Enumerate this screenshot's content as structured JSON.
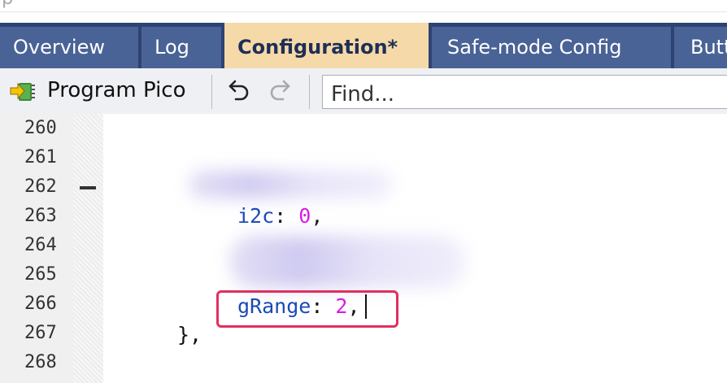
{
  "window": {
    "title_fragment": "ip"
  },
  "tabs": [
    {
      "label": "Overview",
      "active": false
    },
    {
      "label": "Log",
      "active": false
    },
    {
      "label": "Configuration*",
      "active": true
    },
    {
      "label": "Safe-mode Config",
      "active": false
    },
    {
      "label": "Butt",
      "active": false
    }
  ],
  "toolbar": {
    "program_label": "Program Pico",
    "find_placeholder": "Find..."
  },
  "editor": {
    "line_numbers": [
      "260",
      "261",
      "262",
      "263",
      "264",
      "265",
      "266",
      "267",
      "268"
    ],
    "lines": {
      "l263_key": "i2c",
      "l263_colon": ": ",
      "l263_value": "0",
      "l263_comma": ",",
      "l266_key": "gRange",
      "l266_colon": ": ",
      "l266_value": "2",
      "l266_comma": ",",
      "l267_text": "},"
    }
  },
  "colors": {
    "tabbar": "#2e4372",
    "tab_inactive": "#4a6396",
    "tab_active": "#f5d9a8",
    "key": "#1a4bb5",
    "number": "#d81be8",
    "highlight_border": "#e0305e"
  }
}
